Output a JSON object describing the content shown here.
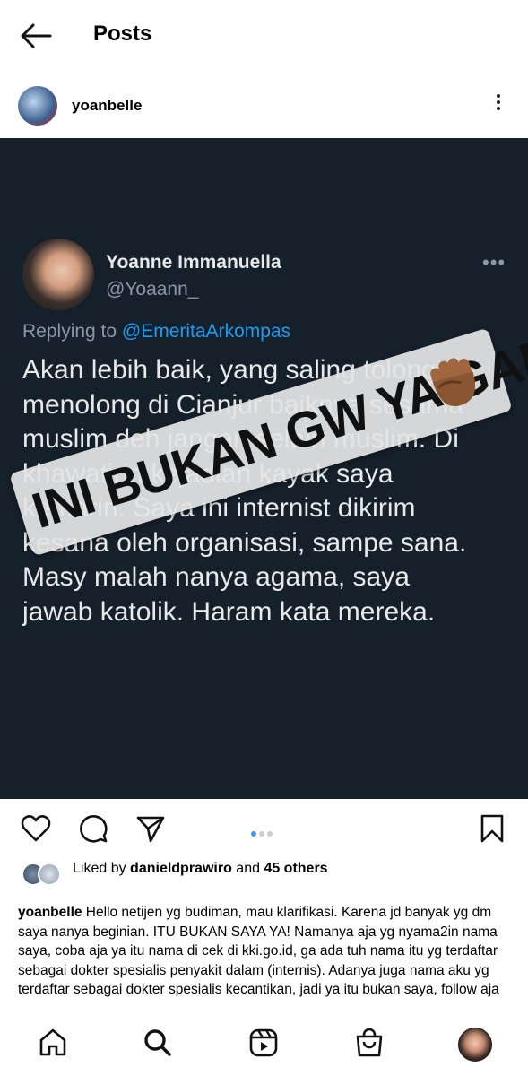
{
  "header": {
    "title": "Posts",
    "back_icon": "arrow-left-icon"
  },
  "post_author": {
    "username": "yoanbelle",
    "menu_icon": "more-vertical-icon"
  },
  "tweet": {
    "display_name": "Yoanne Immanuella",
    "handle": "@Yoaann_",
    "menu_dots": "•••",
    "replying_label": "Replying to ",
    "replying_mention": "@EmeritaArkompas",
    "lines": [
      "Akan lebih baik, yang saling tolong",
      "menolong di Cianjur baiknya sesama",
      "muslim deh jangan selain muslim. Di",
      "khawatirin kejadian kayak saya",
      "kemarin. Saya ini internist dikirim",
      "kesana oleh organisasi, sampe sana.",
      "Masy malah nanya agama, saya",
      "jawab katolik. Haram kata mereka."
    ],
    "background_color": "#15202b",
    "mention_color": "#1d9bf0"
  },
  "sticker": {
    "text": "INI BUKAN GW YA GAES",
    "emoji": "raised-fist-icon"
  },
  "actions": {
    "icons": [
      "heart-icon",
      "comment-icon",
      "share-icon",
      "bookmark-icon"
    ],
    "carousel_pages": 3,
    "carousel_active": 1,
    "accent_color": "#3897f0"
  },
  "likes": {
    "prefix": "Liked by ",
    "user": "danieldprawiro",
    "connector": " and ",
    "count": "45 others"
  },
  "caption": {
    "username": "yoanbelle",
    "text": " Hello netijen yg budiman, mau klarifikasi. Karena jd banyak yg dm saya nanya beginian. ITU BUKAN SAYA YA! Namanya aja yg nyama2in nama saya, coba aja ya itu nama di cek di kki.go.id, ga ada tuh nama itu yg terdaftar sebagai dokter spesialis penyakit dalam (internis). Adanya juga nama aku yg terdaftar sebagai dokter spesialis kecantikan, jadi ya itu bukan saya, follow aja"
  },
  "tabbar": {
    "icons": [
      "home-icon",
      "search-icon",
      "reels-icon",
      "shop-icon",
      "profile-avatar"
    ]
  }
}
